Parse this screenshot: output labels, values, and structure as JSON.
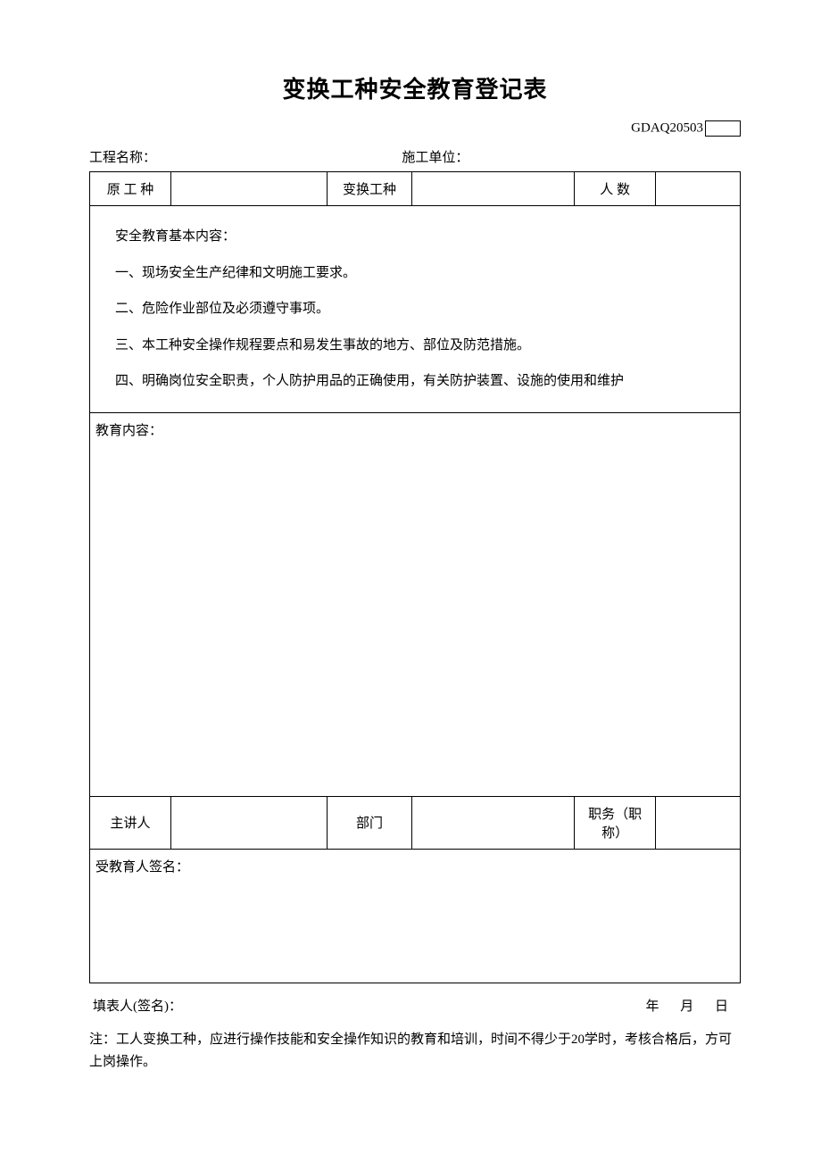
{
  "title": "变换工种安全教育登记表",
  "code_prefix": "GDAQ20503",
  "header": {
    "project_label": "工程名称：",
    "project_value": "",
    "unit_label": "施工单位：",
    "unit_value": ""
  },
  "row1": {
    "orig_type_label": "原 工 种",
    "orig_type_value": "",
    "change_type_label": "变换工种",
    "change_type_value": "",
    "count_label": "人 数",
    "count_value": ""
  },
  "basic": {
    "heading": "安全教育基本内容：",
    "item1": "一、现场安全生产纪律和文明施工要求。",
    "item2": "二、危险作业部位及必须遵守事项。",
    "item3": "三、本工种安全操作规程要点和易发生事故的地方、部位及防范措施。",
    "item4": "四、明确岗位安全职责，个人防护用品的正确使用，有关防护装置、设施的使用和维护"
  },
  "edu": {
    "heading": "教育内容：",
    "body": ""
  },
  "row_lecturer": {
    "lecturer_label": "主讲人",
    "lecturer_value": "",
    "dept_label": "部门",
    "dept_value": "",
    "position_label": "职务（职称）",
    "position_value": ""
  },
  "signature": {
    "heading": "受教育人签名：",
    "body": ""
  },
  "footer": {
    "filler_label": "填表人(签名)：",
    "year": "年",
    "month": "月",
    "day": "日"
  },
  "note": "注：工人变换工种，应进行操作技能和安全操作知识的教育和培训，时间不得少于20学时，考核合格后，方可上岗操作。"
}
